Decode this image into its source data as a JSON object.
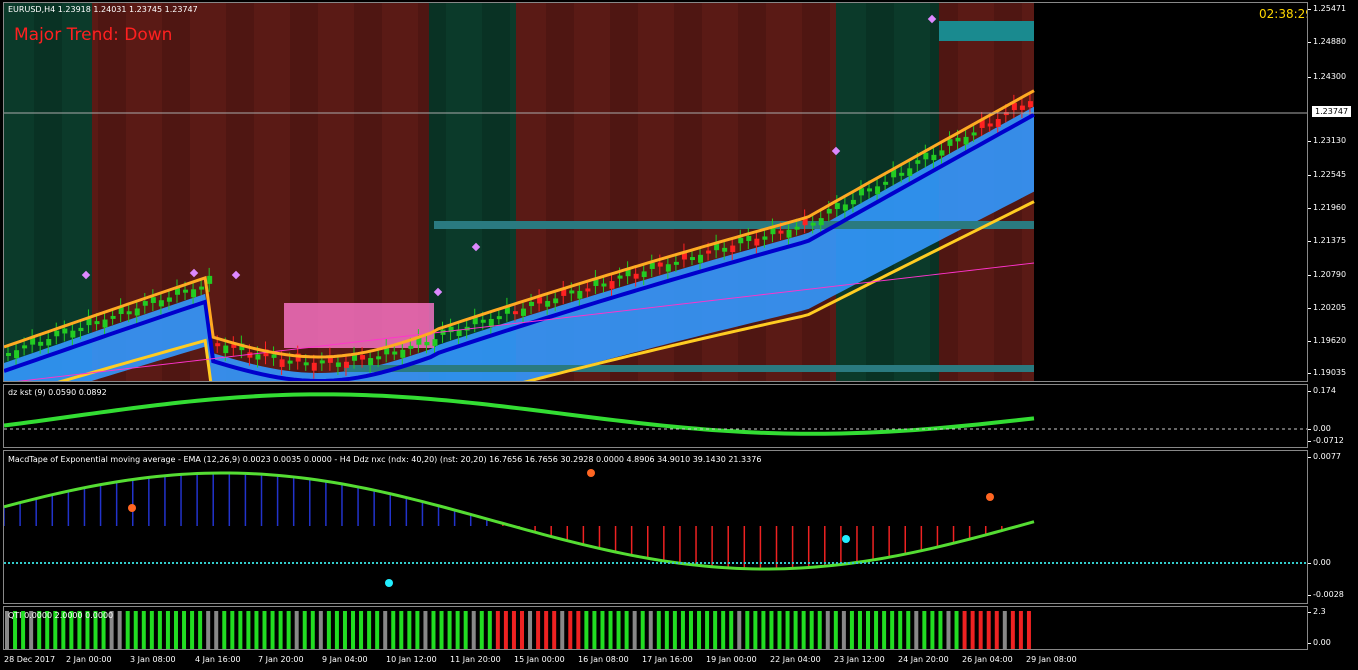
{
  "symbol_header": "EURUSD,H4  1.23918 1.24031 1.23745 1.23747",
  "clock": "02:38:29",
  "trend_text": "Major Trend: Down",
  "current_price": "1.23747",
  "main_axis": [
    "1.25471",
    "1.24880",
    "1.24300",
    "1.23130",
    "1.22545",
    "1.21960",
    "1.21375",
    "1.20790",
    "1.20205",
    "1.19620",
    "1.19035"
  ],
  "kst": {
    "label": "dz kst (9) 0.0590 0.0892",
    "ticks": [
      "0.174",
      "0.00",
      "-0.0712"
    ]
  },
  "macd": {
    "label": "MacdTape of Exponential moving average - EMA (12,26,9) 0.0023 0.0035 0.0000 - H4 Ddz nxc (ndx: 40,20) (nst: 20,20) 16.7656 16.7656 30.2928 0.0000 4.8906 34.9010 39.1430 21.3376",
    "ticks": [
      "0.0077",
      "0.00",
      "-0.0028"
    ]
  },
  "qti": {
    "label": "QTI 0.0000 2.0000 0.0000",
    "ticks": [
      "2.3",
      "0.00"
    ]
  },
  "dates": [
    "28 Dec 2017",
    "2 Jan 00:00",
    "3 Jan 08:00",
    "4 Jan 16:00",
    "7 Jan 20:00",
    "9 Jan 04:00",
    "10 Jan 12:00",
    "11 Jan 20:00",
    "15 Jan 00:00",
    "16 Jan 08:00",
    "17 Jan 16:00",
    "19 Jan 00:00",
    "22 Jan 04:00",
    "23 Jan 12:00",
    "24 Jan 20:00",
    "26 Jan 04:00",
    "29 Jan 08:00"
  ],
  "colors": {
    "bull": "#22cc22",
    "bear": "#ff2222",
    "cloud": "#3399ff",
    "bg_bear": "#5a1a15",
    "bg_bull": "#0b3a2a"
  }
}
